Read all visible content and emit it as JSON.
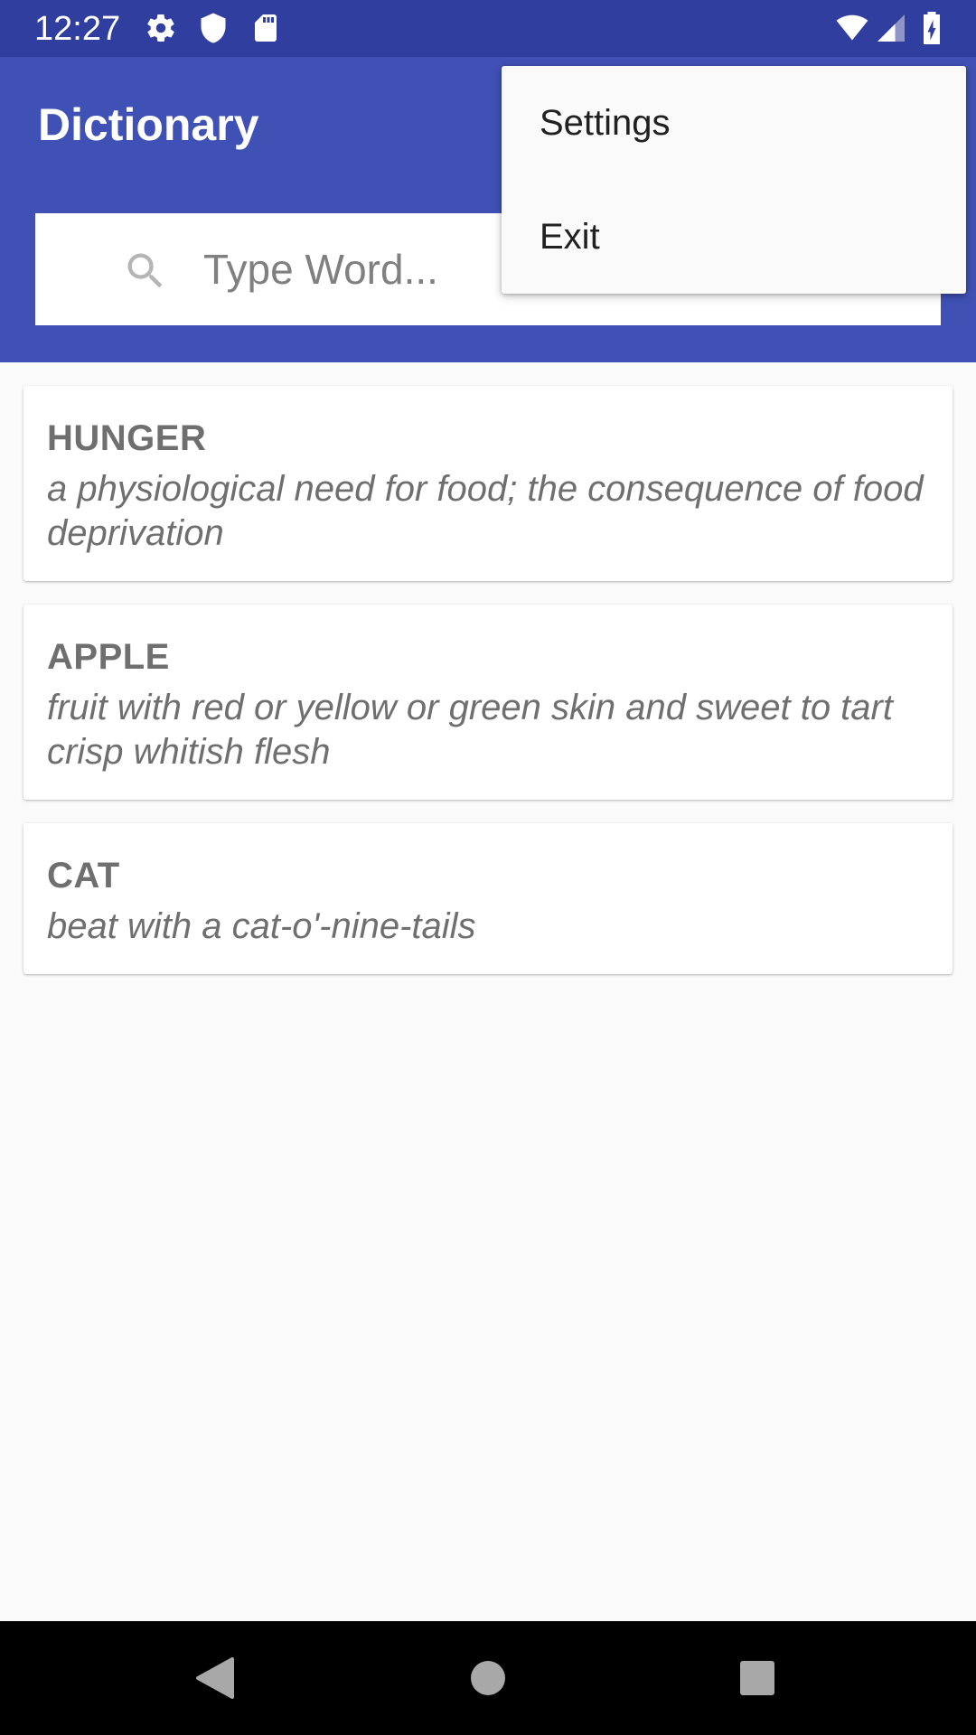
{
  "status_bar": {
    "time": "12:27",
    "icons": [
      "gear-icon",
      "shield-icon",
      "sd-card-icon",
      "wifi-icon",
      "signal-icon",
      "battery-charging-icon"
    ]
  },
  "app_bar": {
    "title": "Dictionary",
    "background": "#3f51b5",
    "status_background": "#303f9f"
  },
  "search": {
    "placeholder": "Type Word...",
    "value": ""
  },
  "words": [
    {
      "word": "HUNGER",
      "definition": "a physiological need for food; the consequence of food deprivation"
    },
    {
      "word": "APPLE",
      "definition": "fruit with red or yellow or green skin and sweet to tart crisp whitish flesh"
    },
    {
      "word": "CAT",
      "definition": "beat with a cat-o'-nine-tails"
    }
  ],
  "menu": {
    "items": [
      {
        "label": "Settings"
      },
      {
        "label": "Exit"
      }
    ]
  },
  "nav_bar": {
    "buttons": [
      "back-icon",
      "home-icon",
      "recents-icon"
    ]
  }
}
